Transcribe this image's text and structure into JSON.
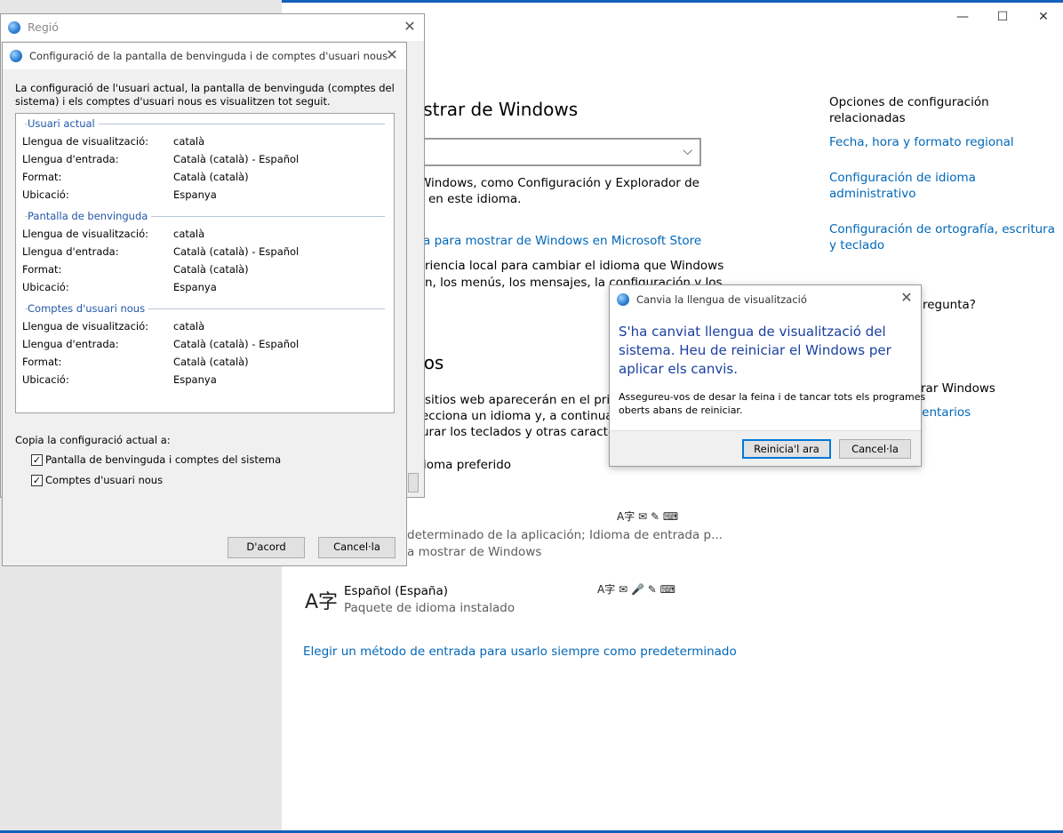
{
  "settings": {
    "window_controls": {
      "minimize": "—",
      "maximize": "☐",
      "close": "✕"
    },
    "heading_display": "ostrar de Windows",
    "display_desc_1": "Windows, como Configuración y Explorador de",
    "display_desc_2": "en este idioma.",
    "store_link": "a para mostrar de Windows en Microsoft Store",
    "region_desc_1": "riencia local para cambiar el idioma que Windows",
    "region_desc_2": "n, los menús, los mensajes, la configuración y los",
    "heading_preferred": "dos",
    "pref_desc_1": "sitios web aparecerán en el primer",
    "pref_desc_2": "ecciona un idioma y, a continuació",
    "pref_desc_3": "urar los teclados y otras caracterist",
    "add_preferred": "ioma preferido",
    "lang1_sub1": "determinado de la aplicación; Idioma de entrada p...",
    "lang1_sub2": "a mostrar de Windows",
    "lang2_name": "Español (España)",
    "lang2_sub": "Paquete de idioma instalado",
    "input_method_link": "Elegir un método de entrada para usarlo siempre como predeterminado",
    "related_title_1": "Opciones de configuración",
    "related_title_2": "relacionadas",
    "related_link_1": "Fecha, hora y formato regional",
    "related_link_2a": "Configuración de idioma",
    "related_link_2b": "administrativo",
    "related_link_3a": "Configuración de ortografía, escritura",
    "related_link_3b": "y teclado",
    "question_partial": "regunta?",
    "improve_partial": "rar Windows",
    "feedback_partial": "mentarios",
    "icons": {
      "lang_glyph": "A字",
      "feature_icons_1": [
        "A字",
        "✉",
        "✎",
        "⌨"
      ],
      "feature_icons_2": [
        "A字",
        "✉",
        "🎤",
        "✎",
        "⌨"
      ]
    }
  },
  "region_dialog": {
    "title": "Regió",
    "close": "✕"
  },
  "welcome_dialog": {
    "title": "Configuració de la pantalla de benvinguda i de comptes d'usuari nous",
    "close": "✕",
    "intro_1": "La configuració de l'usuari actual, la pantalla de benvinguda (comptes del",
    "intro_2": "sistema) i els comptes d'usuari nous es visualitzen tot seguit.",
    "groups": [
      {
        "title": "Usuari actual",
        "rows": [
          {
            "label": "Llengua de visualització:",
            "value": "català"
          },
          {
            "label": "Llengua d'entrada:",
            "value": "Català (català) - Español"
          },
          {
            "label": "Format:",
            "value": "Català (català)"
          },
          {
            "label": "Ubicació:",
            "value": "Espanya"
          }
        ]
      },
      {
        "title": "Pantalla de benvinguda",
        "rows": [
          {
            "label": "Llengua de visualització:",
            "value": "català"
          },
          {
            "label": "Llengua d'entrada:",
            "value": "Català (català) - Español"
          },
          {
            "label": "Format:",
            "value": "Català (català)"
          },
          {
            "label": "Ubicació:",
            "value": "Espanya"
          }
        ]
      },
      {
        "title": "Comptes d'usuari nous",
        "rows": [
          {
            "label": "Llengua de visualització:",
            "value": "català"
          },
          {
            "label": "Llengua d'entrada:",
            "value": "Català (català) - Español"
          },
          {
            "label": "Format:",
            "value": "Català (català)"
          },
          {
            "label": "Ubicació:",
            "value": "Espanya"
          }
        ]
      }
    ],
    "copy_label": "Copia la configuració actual a:",
    "checkbox_1": {
      "label": "Pantalla de benvinguda i comptes del sistema",
      "checked": true,
      "mark": "✓"
    },
    "checkbox_2": {
      "label": "Comptes d'usuari nous",
      "checked": true,
      "mark": "✓"
    },
    "ok_button": "D'acord",
    "cancel_button": "Cancel·la"
  },
  "change_dialog": {
    "title": "Canvia la llengua de visualització",
    "close": "✕",
    "message_1": "S'ha canviat llengua de visualització del",
    "message_2": "sistema. Heu de reiniciar el Windows per",
    "message_3": "aplicar els canvis.",
    "detail_1": "Assegureu-vos de desar la feina i de tancar tots els programes",
    "detail_2": "oberts abans de reiniciar.",
    "restart_button": "Reinicia'l ara",
    "cancel_button": "Cancel·la"
  }
}
